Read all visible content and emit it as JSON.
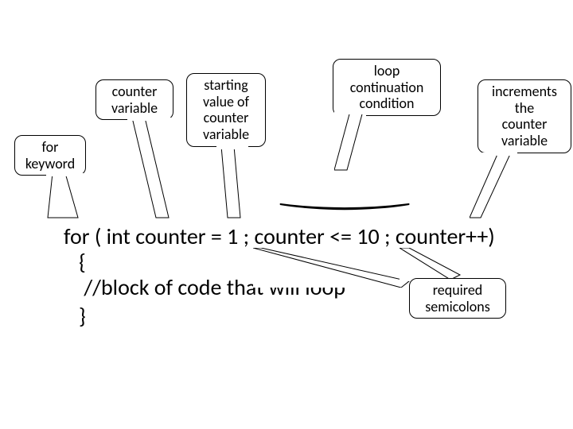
{
  "callouts": {
    "for_keyword": "for\nkeyword",
    "counter_variable": "counter\nvariable",
    "starting_value": "starting\nvalue of\ncounter\nvariable",
    "loop_condition": "loop\ncontinuation\ncondition",
    "increments": "increments\nthe\ncounter\nvariable",
    "semicolons": "required\nsemicolons"
  },
  "code": {
    "line1": "for ( int counter = 1 ; counter <= 10 ; counter++)",
    "line2": "   {",
    "line3": "    //block of code that will loop ",
    "line4": "   }"
  }
}
